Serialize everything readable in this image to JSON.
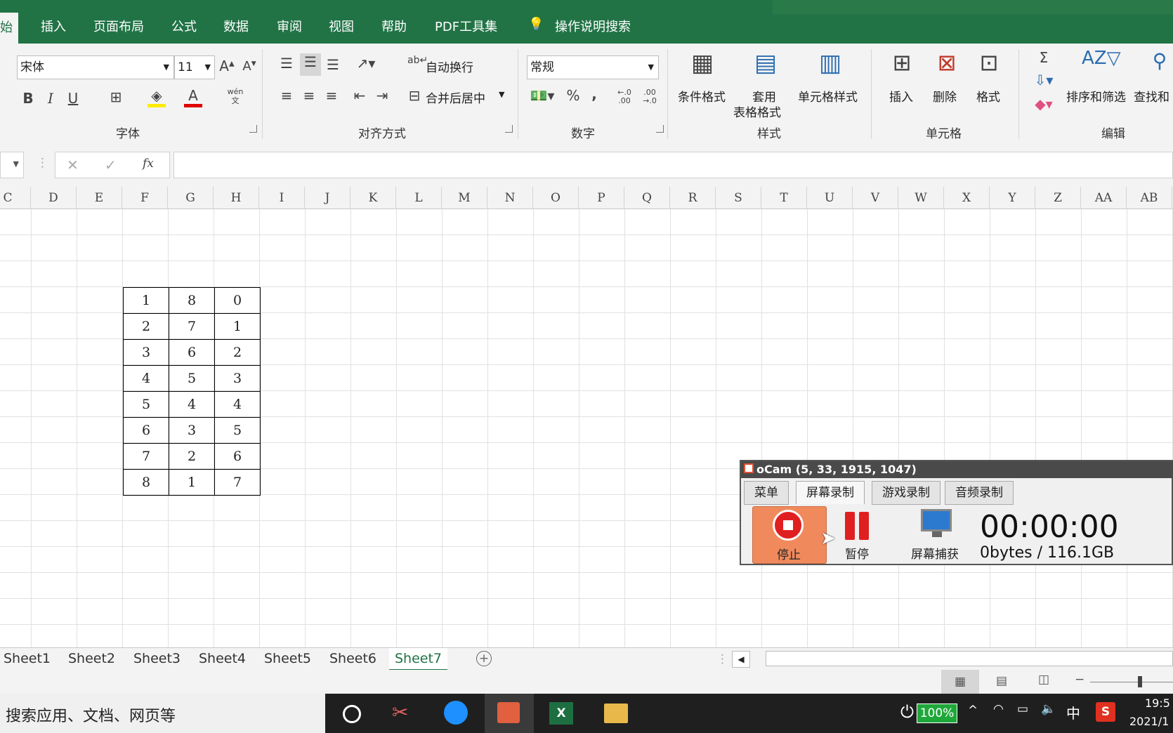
{
  "ribbon_tabs": [
    {
      "label": "始",
      "active": true
    },
    {
      "label": "插入"
    },
    {
      "label": "页面布局"
    },
    {
      "label": "公式"
    },
    {
      "label": "数据"
    },
    {
      "label": "审阅"
    },
    {
      "label": "视图"
    },
    {
      "label": "帮助"
    },
    {
      "label": "PDF工具集"
    }
  ],
  "tell_me": "操作说明搜索",
  "font": {
    "name": "宋体",
    "size": "11",
    "group_label": "字体",
    "bold": "B",
    "italic": "I",
    "underline": "U",
    "phonetic": "wén文"
  },
  "alignment": {
    "group_label": "对齐方式",
    "wrap_text": "自动换行",
    "merge_center": "合并后居中"
  },
  "number": {
    "group_label": "数字",
    "format": "常规",
    "percent": "%",
    "comma": ",",
    "inc_decimal": "←.0 .00",
    "dec_decimal": ".00 →.0"
  },
  "styles": {
    "group_label": "样式",
    "conditional": "条件格式",
    "table_format_1": "套用",
    "table_format_2": "表格格式",
    "cell_styles": "单元格样式"
  },
  "cells": {
    "group_label": "单元格",
    "insert": "插入",
    "delete": "删除",
    "format": "格式"
  },
  "editing": {
    "group_label": "编辑",
    "sum": "Σ",
    "sort_filter": "排序和筛选",
    "find": "查找和"
  },
  "formula_bar": {
    "fx": "fx"
  },
  "columns": [
    "C",
    "D",
    "E",
    "F",
    "G",
    "H",
    "I",
    "J",
    "K",
    "L",
    "M",
    "N",
    "O",
    "P",
    "Q",
    "R",
    "S",
    "T",
    "U",
    "V",
    "W",
    "X",
    "Y",
    "Z",
    "AA",
    "AB"
  ],
  "table_rows": [
    [
      "1",
      "8",
      "0"
    ],
    [
      "2",
      "7",
      "1"
    ],
    [
      "3",
      "6",
      "2"
    ],
    [
      "4",
      "5",
      "3"
    ],
    [
      "5",
      "4",
      "4"
    ],
    [
      "6",
      "3",
      "5"
    ],
    [
      "7",
      "2",
      "6"
    ],
    [
      "8",
      "1",
      "7"
    ]
  ],
  "sheets": [
    {
      "label": "Sheet1"
    },
    {
      "label": "Sheet2"
    },
    {
      "label": "Sheet3"
    },
    {
      "label": "Sheet4"
    },
    {
      "label": "Sheet5"
    },
    {
      "label": "Sheet6"
    },
    {
      "label": "Sheet7",
      "active": true
    }
  ],
  "ocam": {
    "title": "oCam (5, 33, 1915, 1047)",
    "tabs": [
      "菜单",
      "屏幕录制",
      "游戏录制",
      "音频录制"
    ],
    "stop": "停止",
    "pause": "暂停",
    "capture": "屏幕捕获",
    "time": "00:00:00",
    "size": "0bytes / 116.1GB"
  },
  "taskbar": {
    "search": "搜索应用、文档、网页等",
    "battery": "100%",
    "ime": "中",
    "time": "19:5",
    "date": "2021/1"
  }
}
